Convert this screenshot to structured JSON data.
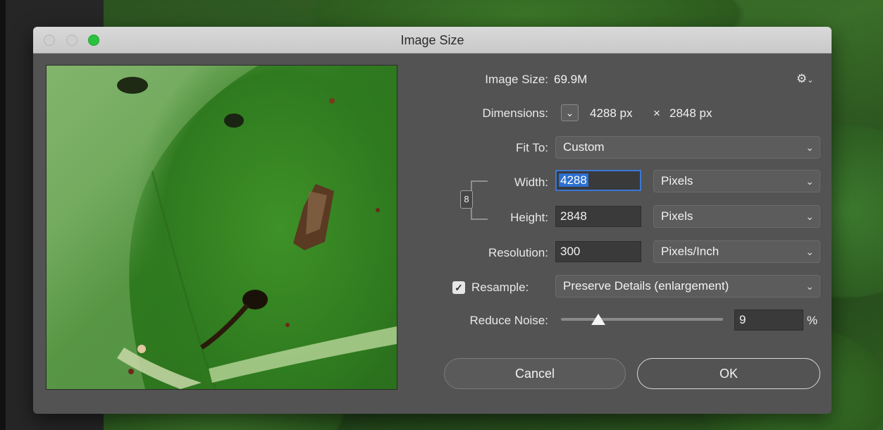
{
  "window": {
    "title": "Image Size"
  },
  "info": {
    "image_size_label": "Image Size:",
    "image_size_value": "69.9M",
    "dimensions_label": "Dimensions:",
    "dimensions_width": "4288 px",
    "dimensions_sep": "×",
    "dimensions_height": "2848 px"
  },
  "fit_to": {
    "label": "Fit To:",
    "value": "Custom"
  },
  "width": {
    "label": "Width:",
    "value": "4288",
    "unit": "Pixels"
  },
  "height": {
    "label": "Height:",
    "value": "2848",
    "unit": "Pixels"
  },
  "resolution": {
    "label": "Resolution:",
    "value": "300",
    "unit": "Pixels/Inch"
  },
  "resample": {
    "label": "Resample:",
    "checked": true,
    "method": "Preserve Details (enlargement)"
  },
  "reduce_noise": {
    "label": "Reduce Noise:",
    "value": "9",
    "unit": "%",
    "slider_fraction": 0.23
  },
  "buttons": {
    "cancel": "Cancel",
    "ok": "OK"
  },
  "icons": {
    "gear": "gear-icon",
    "link": "link-chain-icon",
    "chevron": "chevron-down-icon",
    "check": "checkmark-icon"
  },
  "colors": {
    "accent": "#2d6fd1",
    "dialog_bg": "#535353",
    "zoom_button": "#29c23f"
  }
}
